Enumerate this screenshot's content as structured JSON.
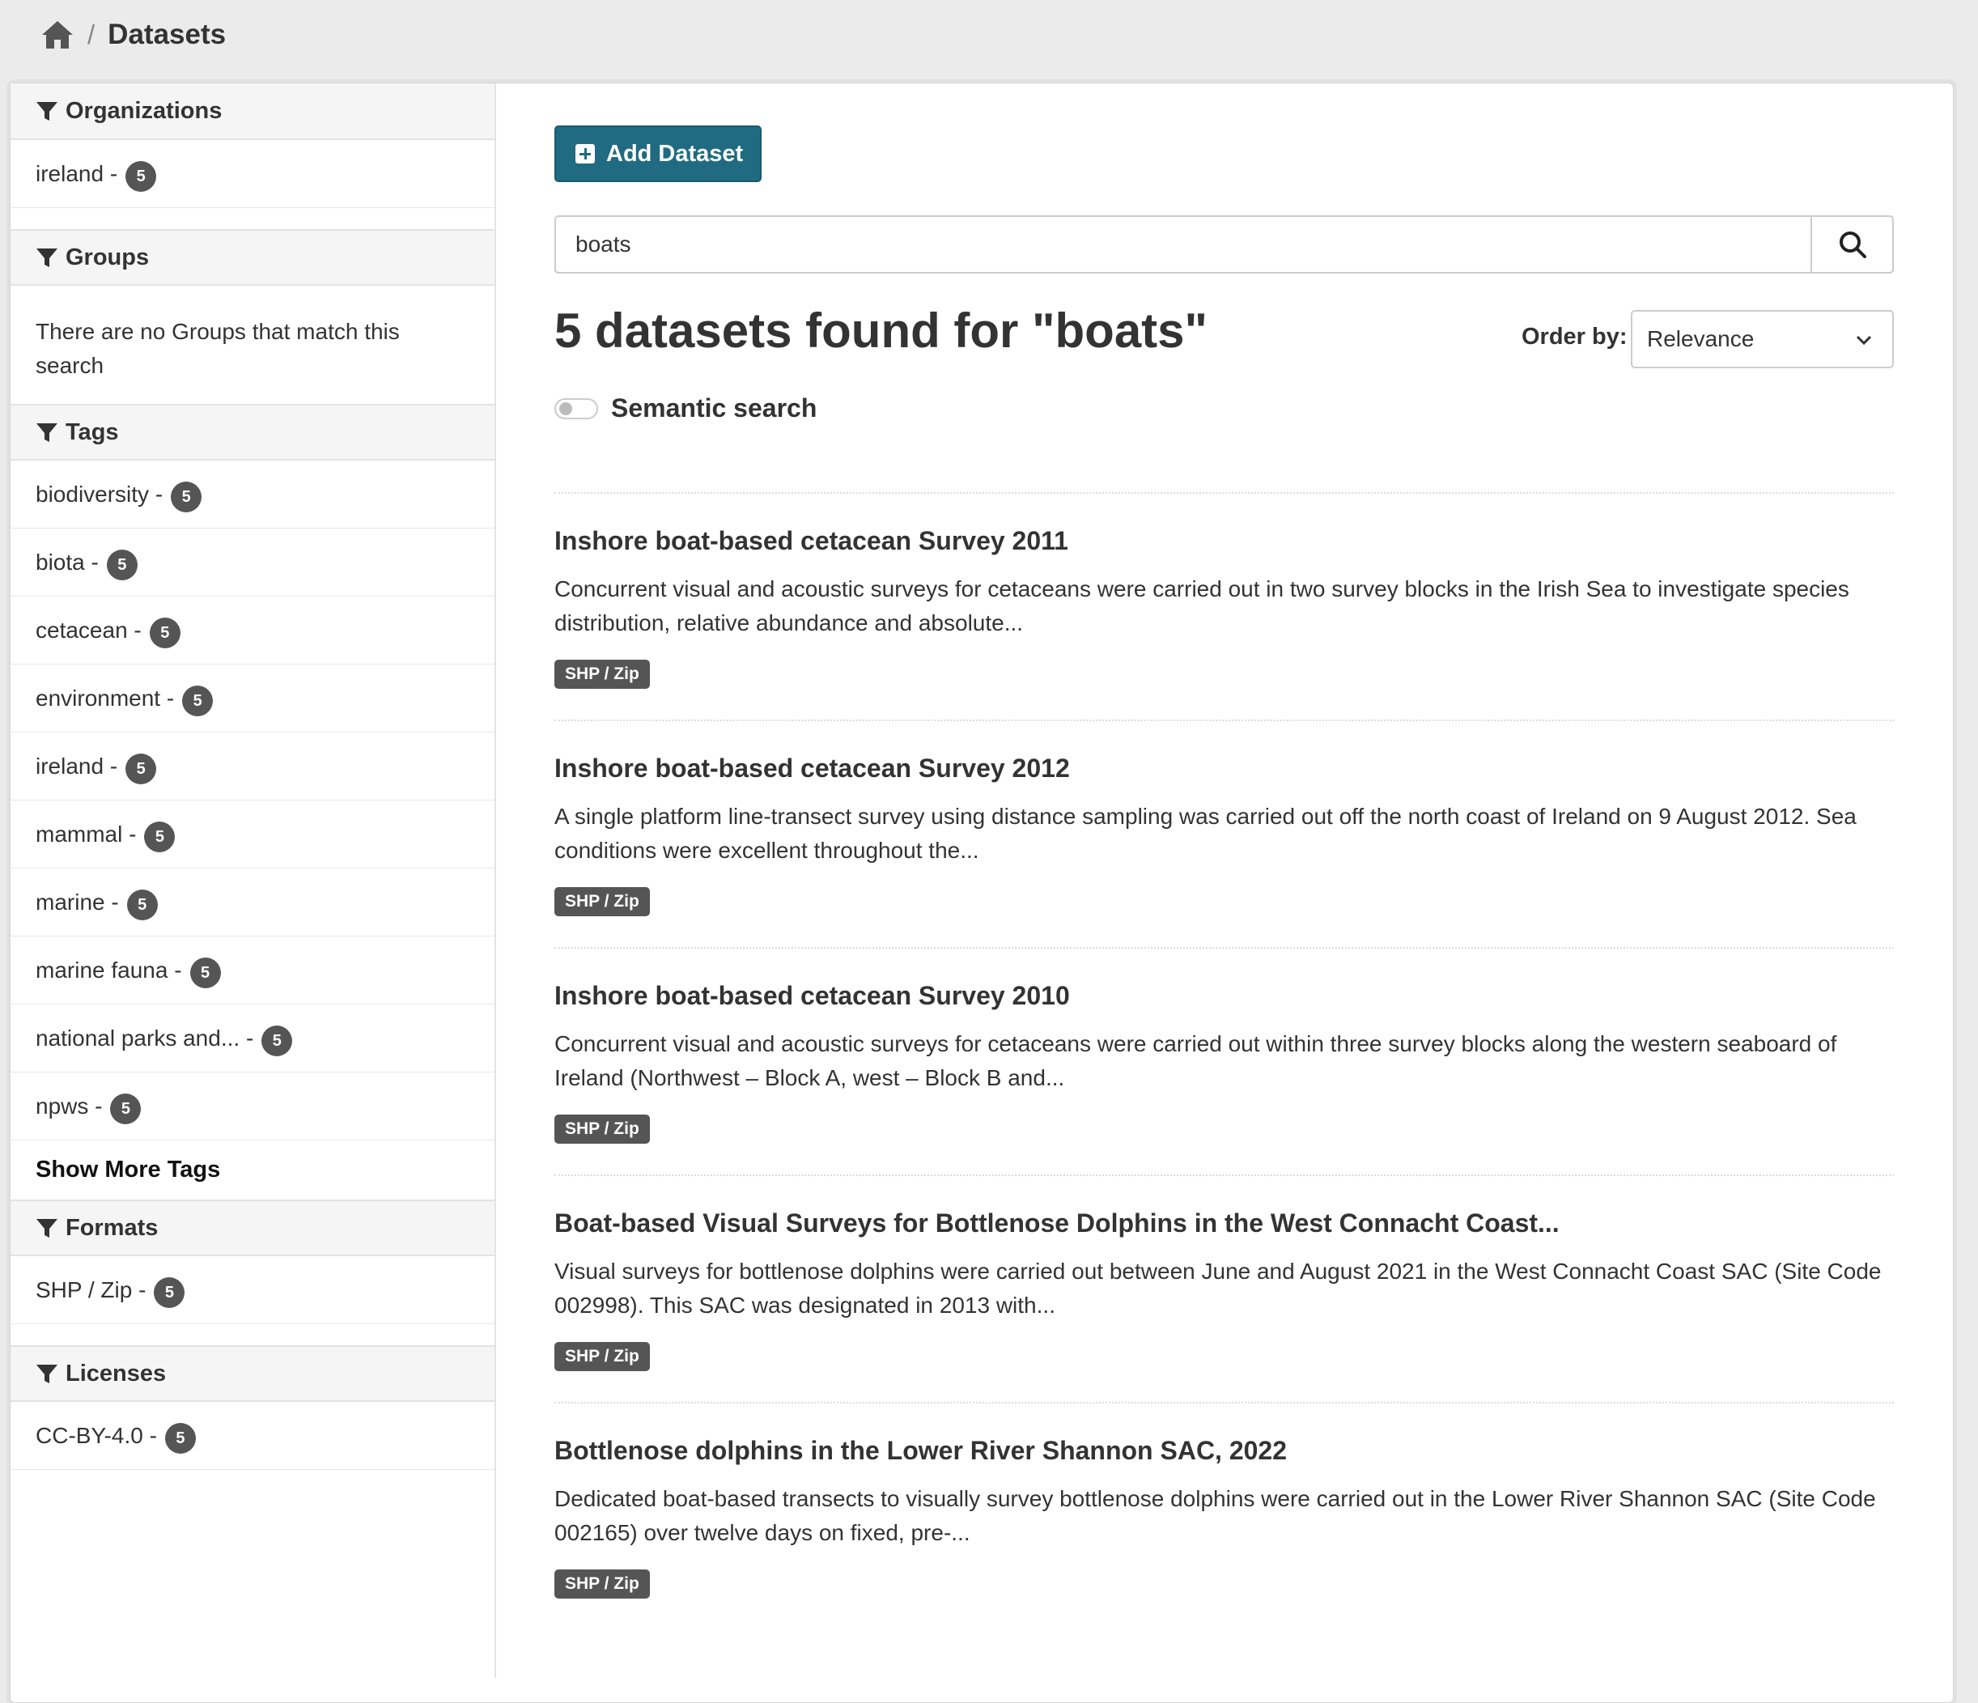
{
  "breadcrumb": {
    "home_icon": "home-icon",
    "separator": "/",
    "current": "Datasets"
  },
  "sidebar": {
    "organizations": {
      "title": "Organizations",
      "items": [
        {
          "label": "ireland - ",
          "count": "5"
        }
      ]
    },
    "groups": {
      "title": "Groups",
      "empty_text": "There are no Groups that match this search"
    },
    "tags": {
      "title": "Tags",
      "items": [
        {
          "label": "biodiversity - ",
          "count": "5"
        },
        {
          "label": "biota - ",
          "count": "5"
        },
        {
          "label": "cetacean - ",
          "count": "5"
        },
        {
          "label": "environment - ",
          "count": "5"
        },
        {
          "label": "ireland - ",
          "count": "5"
        },
        {
          "label": "mammal - ",
          "count": "5"
        },
        {
          "label": "marine - ",
          "count": "5"
        },
        {
          "label": "marine fauna - ",
          "count": "5"
        },
        {
          "label": "national parks and... - ",
          "count": "5"
        },
        {
          "label": "npws - ",
          "count": "5"
        }
      ],
      "show_more": "Show More Tags"
    },
    "formats": {
      "title": "Formats",
      "items": [
        {
          "label": "SHP / Zip - ",
          "count": "5"
        }
      ]
    },
    "licenses": {
      "title": "Licenses",
      "items": [
        {
          "label": "CC-BY-4.0 - ",
          "count": "5"
        }
      ]
    }
  },
  "main": {
    "add_button": "Add Dataset",
    "search": {
      "value": "boats",
      "icon": "search-icon"
    },
    "results_title": "5 datasets found for \"boats\"",
    "order_by": {
      "label": "Order by:",
      "selected": "Relevance"
    },
    "semantic_search": {
      "label": "Semantic search",
      "enabled": false
    },
    "datasets": [
      {
        "title": "Inshore boat-based cetacean Survey 2011",
        "description": "Concurrent visual and acoustic surveys for cetaceans were carried out in two survey blocks in the Irish Sea to investigate species distribution, relative abundance and absolute...",
        "format": "SHP / Zip"
      },
      {
        "title": "Inshore boat-based cetacean Survey 2012",
        "description": "A single platform line-transect survey using distance sampling was carried out off the north coast of Ireland on 9 August 2012. Sea conditions were excellent throughout the...",
        "format": "SHP / Zip"
      },
      {
        "title": "Inshore boat-based cetacean Survey 2010",
        "description": "Concurrent visual and acoustic surveys for cetaceans were carried out within three survey blocks along the western seaboard of Ireland (Northwest – Block A, west – Block B and...",
        "format": "SHP / Zip"
      },
      {
        "title": "Boat-based Visual Surveys for Bottlenose Dolphins in the West Connacht Coast...",
        "description": "Visual surveys for bottlenose dolphins were carried out between June and August 2021 in the West Connacht Coast SAC (Site Code 002998). This SAC was designated in 2013 with...",
        "format": "SHP / Zip"
      },
      {
        "title": "Bottlenose dolphins in the Lower River Shannon SAC, 2022",
        "description": "Dedicated boat-based transects to visually survey bottlenose dolphins were carried out in the Lower River Shannon SAC (Site Code 002165) over twelve days on fixed, pre-...",
        "format": "SHP / Zip"
      }
    ]
  },
  "colors": {
    "accent": "#206b82",
    "badge": "#555555",
    "page_bg": "#ebebeb"
  }
}
